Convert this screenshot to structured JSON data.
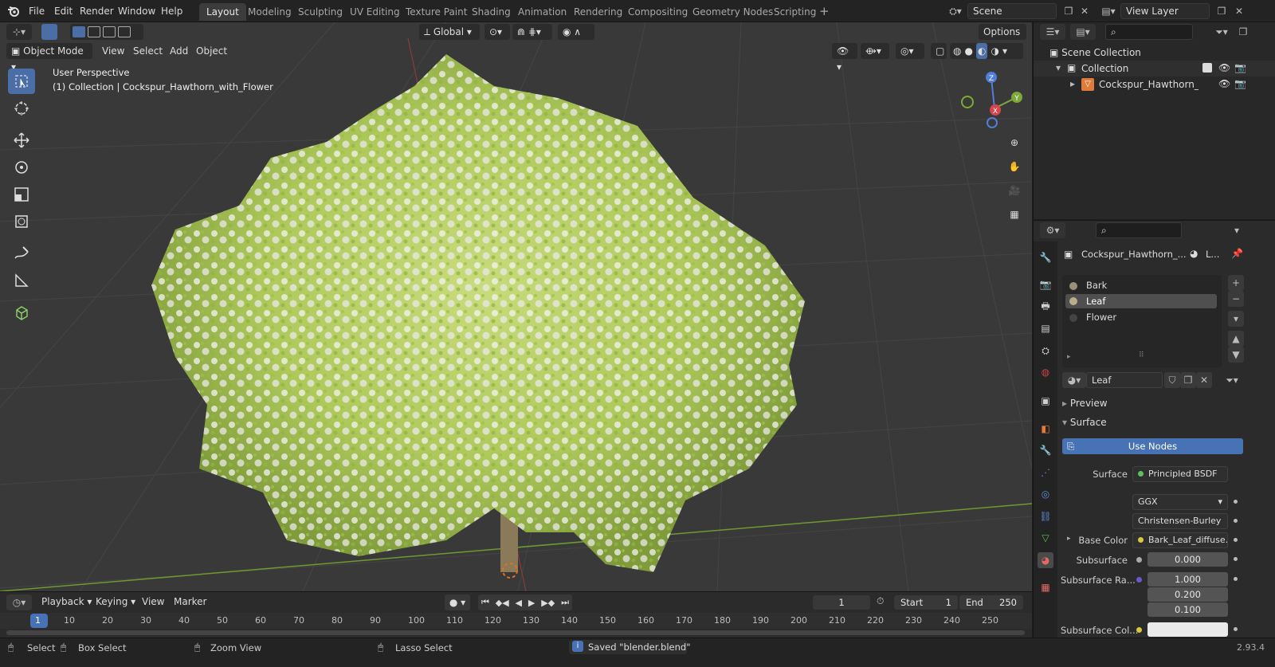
{
  "menu": {
    "file": "File",
    "edit": "Edit",
    "render": "Render",
    "window": "Window",
    "help": "Help"
  },
  "workspaces": [
    "Layout",
    "Modeling",
    "Sculpting",
    "UV Editing",
    "Texture Paint",
    "Shading",
    "Animation",
    "Rendering",
    "Compositing",
    "Geometry Nodes",
    "Scripting"
  ],
  "scene": {
    "name": "Scene",
    "view_layer": "View Layer"
  },
  "viewport": {
    "transform_orientation": "Global",
    "options_label": "Options",
    "mode": "Object Mode",
    "menus": [
      "View",
      "Select",
      "Add",
      "Object"
    ],
    "overlay_line1": "User Perspective",
    "overlay_line2": "(1) Collection | Cockspur_Hawthorn_with_Flower",
    "gizmo": {
      "x": "X",
      "y": "Y",
      "z": "Z"
    },
    "colors": {
      "bg": "#393939",
      "grid": "#4a4a4a",
      "x_axis": "#8a3b3b",
      "y_axis": "#6e9a2f",
      "leaf": "#b8d65a",
      "flower": "#eeeeee"
    }
  },
  "timeline": {
    "menus": [
      "Playback",
      "Keying",
      "View",
      "Marker"
    ],
    "current_frame": "1",
    "start_label": "Start",
    "start": "1",
    "end_label": "End",
    "end": "250",
    "ruler": [
      "1",
      "10",
      "20",
      "30",
      "40",
      "50",
      "60",
      "70",
      "80",
      "90",
      "100",
      "110",
      "120",
      "130",
      "140",
      "150",
      "160",
      "170",
      "180",
      "190",
      "200",
      "210",
      "220",
      "230",
      "240",
      "250"
    ]
  },
  "outliner": {
    "scene_collection": "Scene Collection",
    "collection": "Collection",
    "object": "Cockspur_Hawthorn_with"
  },
  "properties": {
    "object_name": "Cockspur_Hawthorn_...",
    "material_short": "L...",
    "slots": [
      "Bark",
      "Leaf",
      "Flower"
    ],
    "selected_slot": "Leaf",
    "material_name": "Leaf",
    "preview_label": "Preview",
    "surface_section": "Surface",
    "use_nodes": "Use Nodes",
    "surface_label": "Surface",
    "surface_value": "Principled BSDF",
    "distribution": "GGX",
    "subsurface_method": "Christensen-Burley",
    "base_color_label": "Base Color",
    "base_color_value": "Bark_Leaf_diffuse....",
    "subsurface_label": "Subsurface",
    "subsurface_value": "0.000",
    "subsurface_radius_label": "Subsurface Ra...",
    "subsurface_radius": [
      "1.000",
      "0.200",
      "0.100"
    ],
    "subsurface_color_label": "Subsurface Col...",
    "accent": "#4772b3"
  },
  "status": {
    "select": "Select",
    "box_select": "Box Select",
    "zoom_view": "Zoom View",
    "lasso_select": "Lasso Select",
    "message": "Saved \"blender.blend\"",
    "version": "2.93.4"
  }
}
